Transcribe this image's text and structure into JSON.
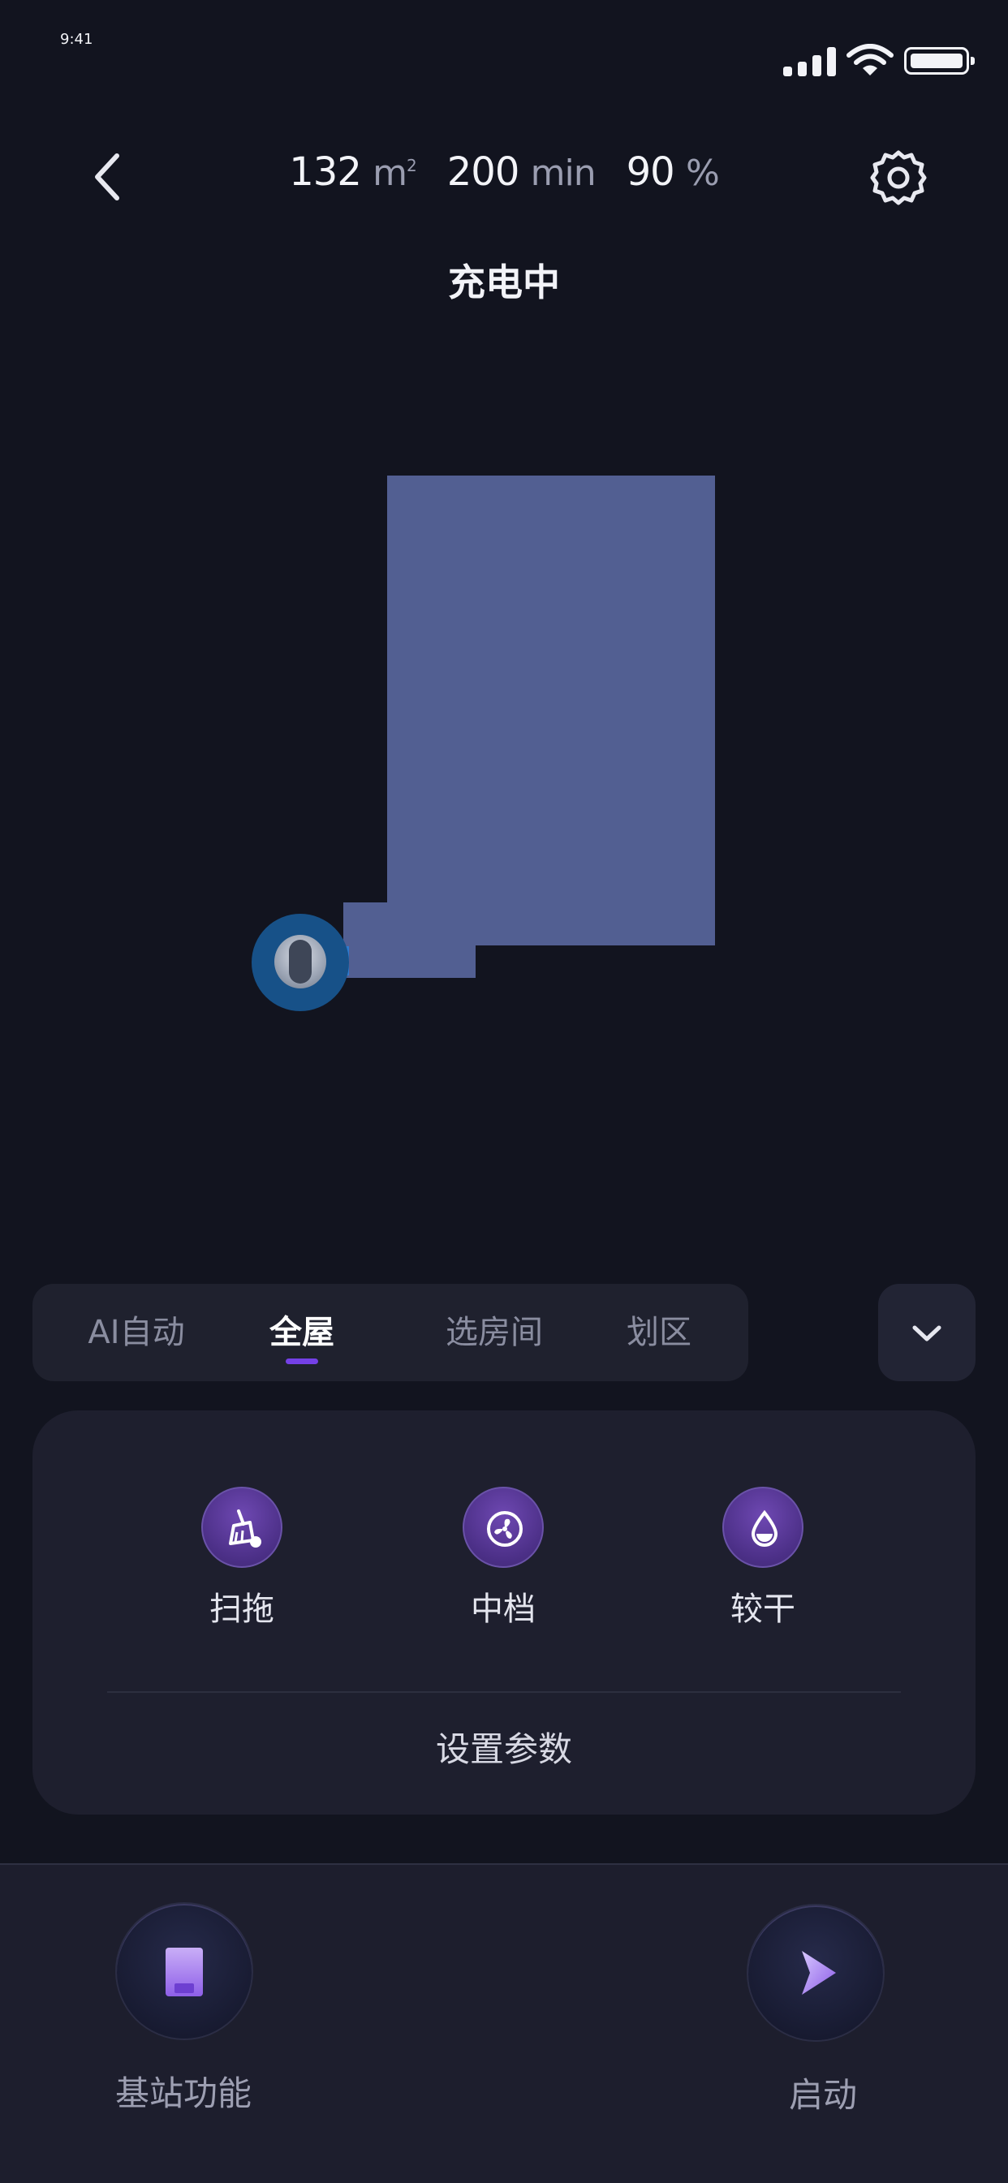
{
  "status_bar": {
    "time": "9:41"
  },
  "header": {
    "area_value": "132",
    "area_unit": "m",
    "area_sup": "2",
    "duration_value": "200",
    "duration_unit": "min",
    "battery_value": "90",
    "battery_unit": "%",
    "status_title": "充电中"
  },
  "colors": {
    "background": "#12141f",
    "map_room": "#525f92",
    "robot_halo": "#175188",
    "accent": "#7440e6"
  },
  "mode_tabs": {
    "items": [
      {
        "label": "AI自动",
        "active": false
      },
      {
        "label": "全屋",
        "active": true
      },
      {
        "label": "选房间",
        "active": false
      },
      {
        "label": "划区",
        "active": false
      }
    ]
  },
  "options": {
    "items": [
      {
        "label": "扫拖",
        "icon": "broom-mop-icon"
      },
      {
        "label": "中档",
        "icon": "fan-icon"
      },
      {
        "label": "较干",
        "icon": "water-drop-icon"
      }
    ],
    "set_params_label": "设置参数"
  },
  "bottom_bar": {
    "station_label": "基站功能",
    "start_label": "启动"
  }
}
